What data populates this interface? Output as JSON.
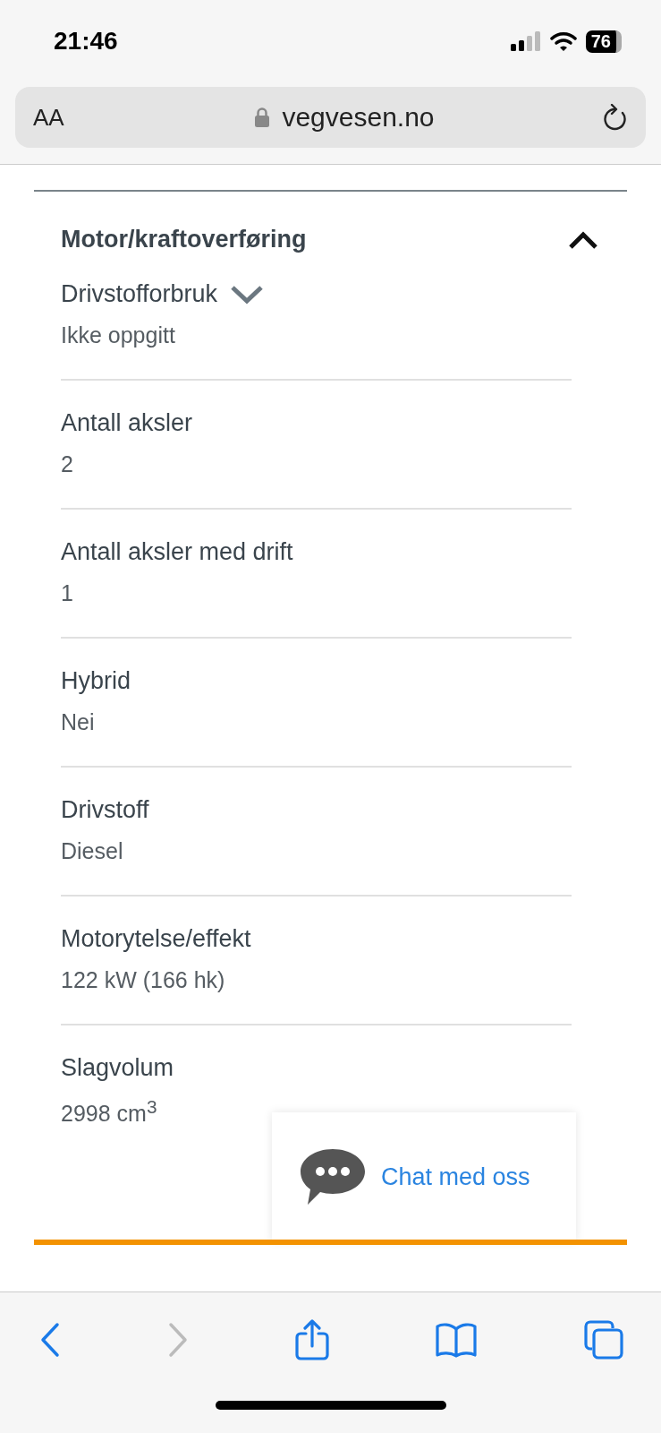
{
  "status_bar": {
    "time": "21:46",
    "battery": "76"
  },
  "address_bar": {
    "text_size": "AA",
    "url": "vegvesen.no"
  },
  "section": {
    "title": "Motor/kraftoverføring",
    "expanded": true,
    "rows": [
      {
        "kind": "dropdown",
        "label": "Drivstofforbruk",
        "value": "Ikke oppgitt"
      },
      {
        "kind": "plain",
        "label": "Antall aksler",
        "value": "2"
      },
      {
        "kind": "plain",
        "label": "Antall aksler med drift",
        "value": "1"
      },
      {
        "kind": "plain",
        "label": "Hybrid",
        "value": "Nei"
      },
      {
        "kind": "plain",
        "label": "Drivstoff",
        "value": "Diesel"
      },
      {
        "kind": "plain",
        "label": "Motorytelse/effekt",
        "value": "122 kW (166 hk)"
      },
      {
        "kind": "plain",
        "label": "Slagvolum",
        "value": "2998 cm$^{3}$"
      }
    ]
  },
  "chat": {
    "label": "Chat med oss"
  },
  "toolbar": [
    {
      "kind": "back",
      "disabled": false
    },
    {
      "kind": "forward",
      "disabled": true
    },
    {
      "kind": "share",
      "disabled": false
    },
    {
      "kind": "bookmarks",
      "disabled": false
    },
    {
      "kind": "tabs",
      "disabled": false
    }
  ]
}
